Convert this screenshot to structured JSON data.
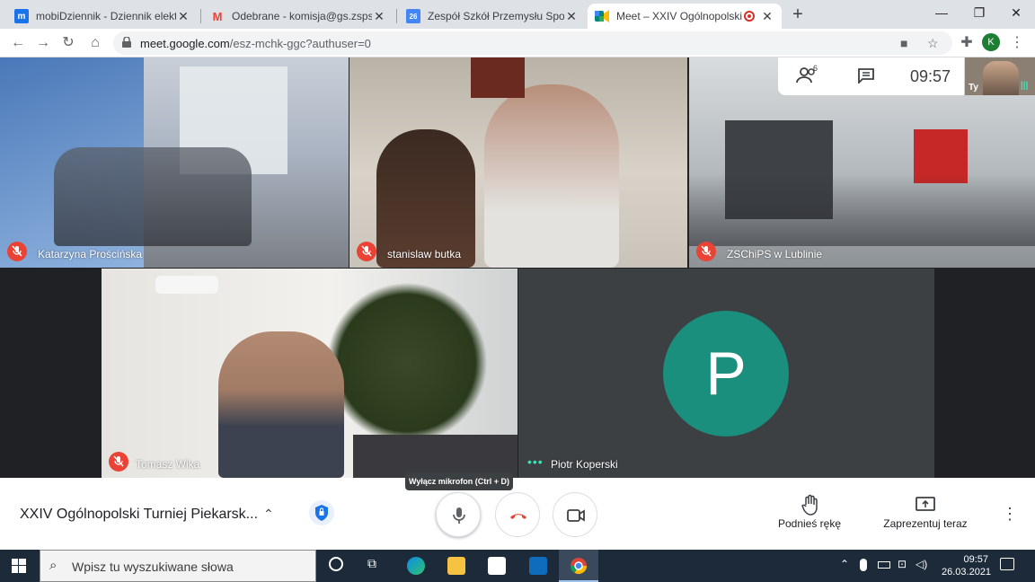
{
  "tabs": [
    {
      "title": "mobiDziennik - Dziennik elektron",
      "favicon": "mobidziennik-icon",
      "color": "#1a73e8"
    },
    {
      "title": "Odebrane - komisja@gs.zsps.poz",
      "favicon": "gmail-icon",
      "color": "#ea4335"
    },
    {
      "title": "Zespół Szkół Przemysłu Spożywc",
      "favicon": "calendar-icon",
      "color": "#4285f4",
      "favicon_text": "26"
    },
    {
      "title": "Meet – XXIV Ogólnopolski Tu",
      "favicon": "meet-icon",
      "color": "#00897b"
    }
  ],
  "address": {
    "host": "meet.google.com",
    "path": "/esz-mchk-ggc?authuser=0"
  },
  "profile_initial": "K",
  "participants": [
    {
      "name": "Katarzyna Prościńska",
      "muted": true
    },
    {
      "name": "stanislaw butka",
      "muted": true
    },
    {
      "name": "ZSChiPS w Lublinie",
      "muted": true
    },
    {
      "name": "Tomasz Wika",
      "muted": true
    },
    {
      "name": "Piotr Koperski",
      "muted": false,
      "avatar_letter": "P",
      "avatar_color": "#1a8f7d"
    }
  ],
  "topbar": {
    "people_count": "6",
    "time": "09:57",
    "self_label": "Ty"
  },
  "controls": {
    "meeting_title": "XXIV Ogólnopolski Turniej Piekarsk...",
    "tooltip": "Wyłącz mikrofon (Ctrl + D)",
    "raise_hand": "Podnieś rękę",
    "present": "Zaprezentuj teraz"
  },
  "taskbar": {
    "search_placeholder": "Wpisz tu wyszukiwane słowa",
    "time": "09:57",
    "date": "26.03.2021"
  }
}
